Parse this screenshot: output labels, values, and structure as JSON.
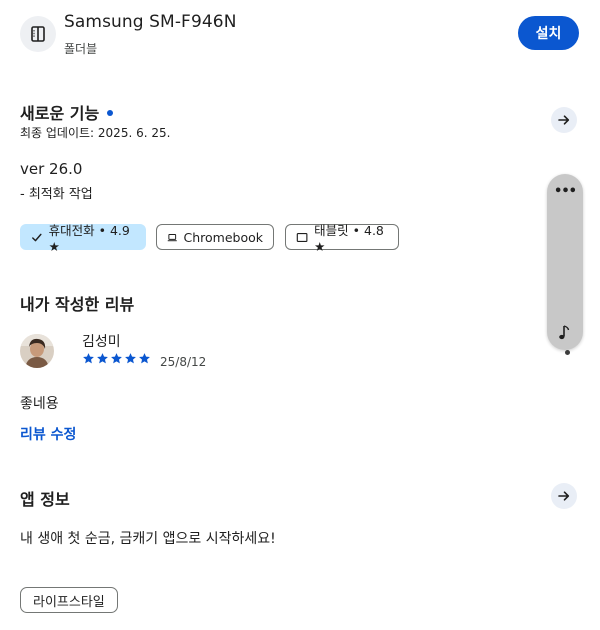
{
  "device": {
    "name": "Samsung SM-F946N",
    "type": "폴더블",
    "icon": "foldable-phone-icon",
    "install_label": "설치"
  },
  "whats_new": {
    "title": "새로운 기능",
    "updated": "최종 업데이트: 2025. 6. 25.",
    "version": "ver 26.0",
    "note": "- 최적화 작업"
  },
  "ratings": [
    {
      "label": "휴대전화 • 4.9 ★",
      "icon": "check-icon",
      "selected": true
    },
    {
      "label": "Chromebook",
      "icon": "laptop-icon",
      "selected": false
    },
    {
      "label": "태블릿 • 4.8 ★",
      "icon": "tablet-icon",
      "selected": false
    }
  ],
  "my_review": {
    "title": "내가 작성한 리뷰",
    "reviewer": "김성미",
    "stars": 5,
    "date": "25/8/12",
    "text": "좋네용",
    "edit_label": "리뷰 수정"
  },
  "app_info": {
    "title": "앱 정보",
    "description": "내 생애 첫 순금, 금캐기 앱으로 시작하세요!",
    "tag": "라이프스타일"
  },
  "colors": {
    "accent": "#0b57d0",
    "chip_selected": "#c2e7ff",
    "arrow_bg": "#e9eef6"
  }
}
